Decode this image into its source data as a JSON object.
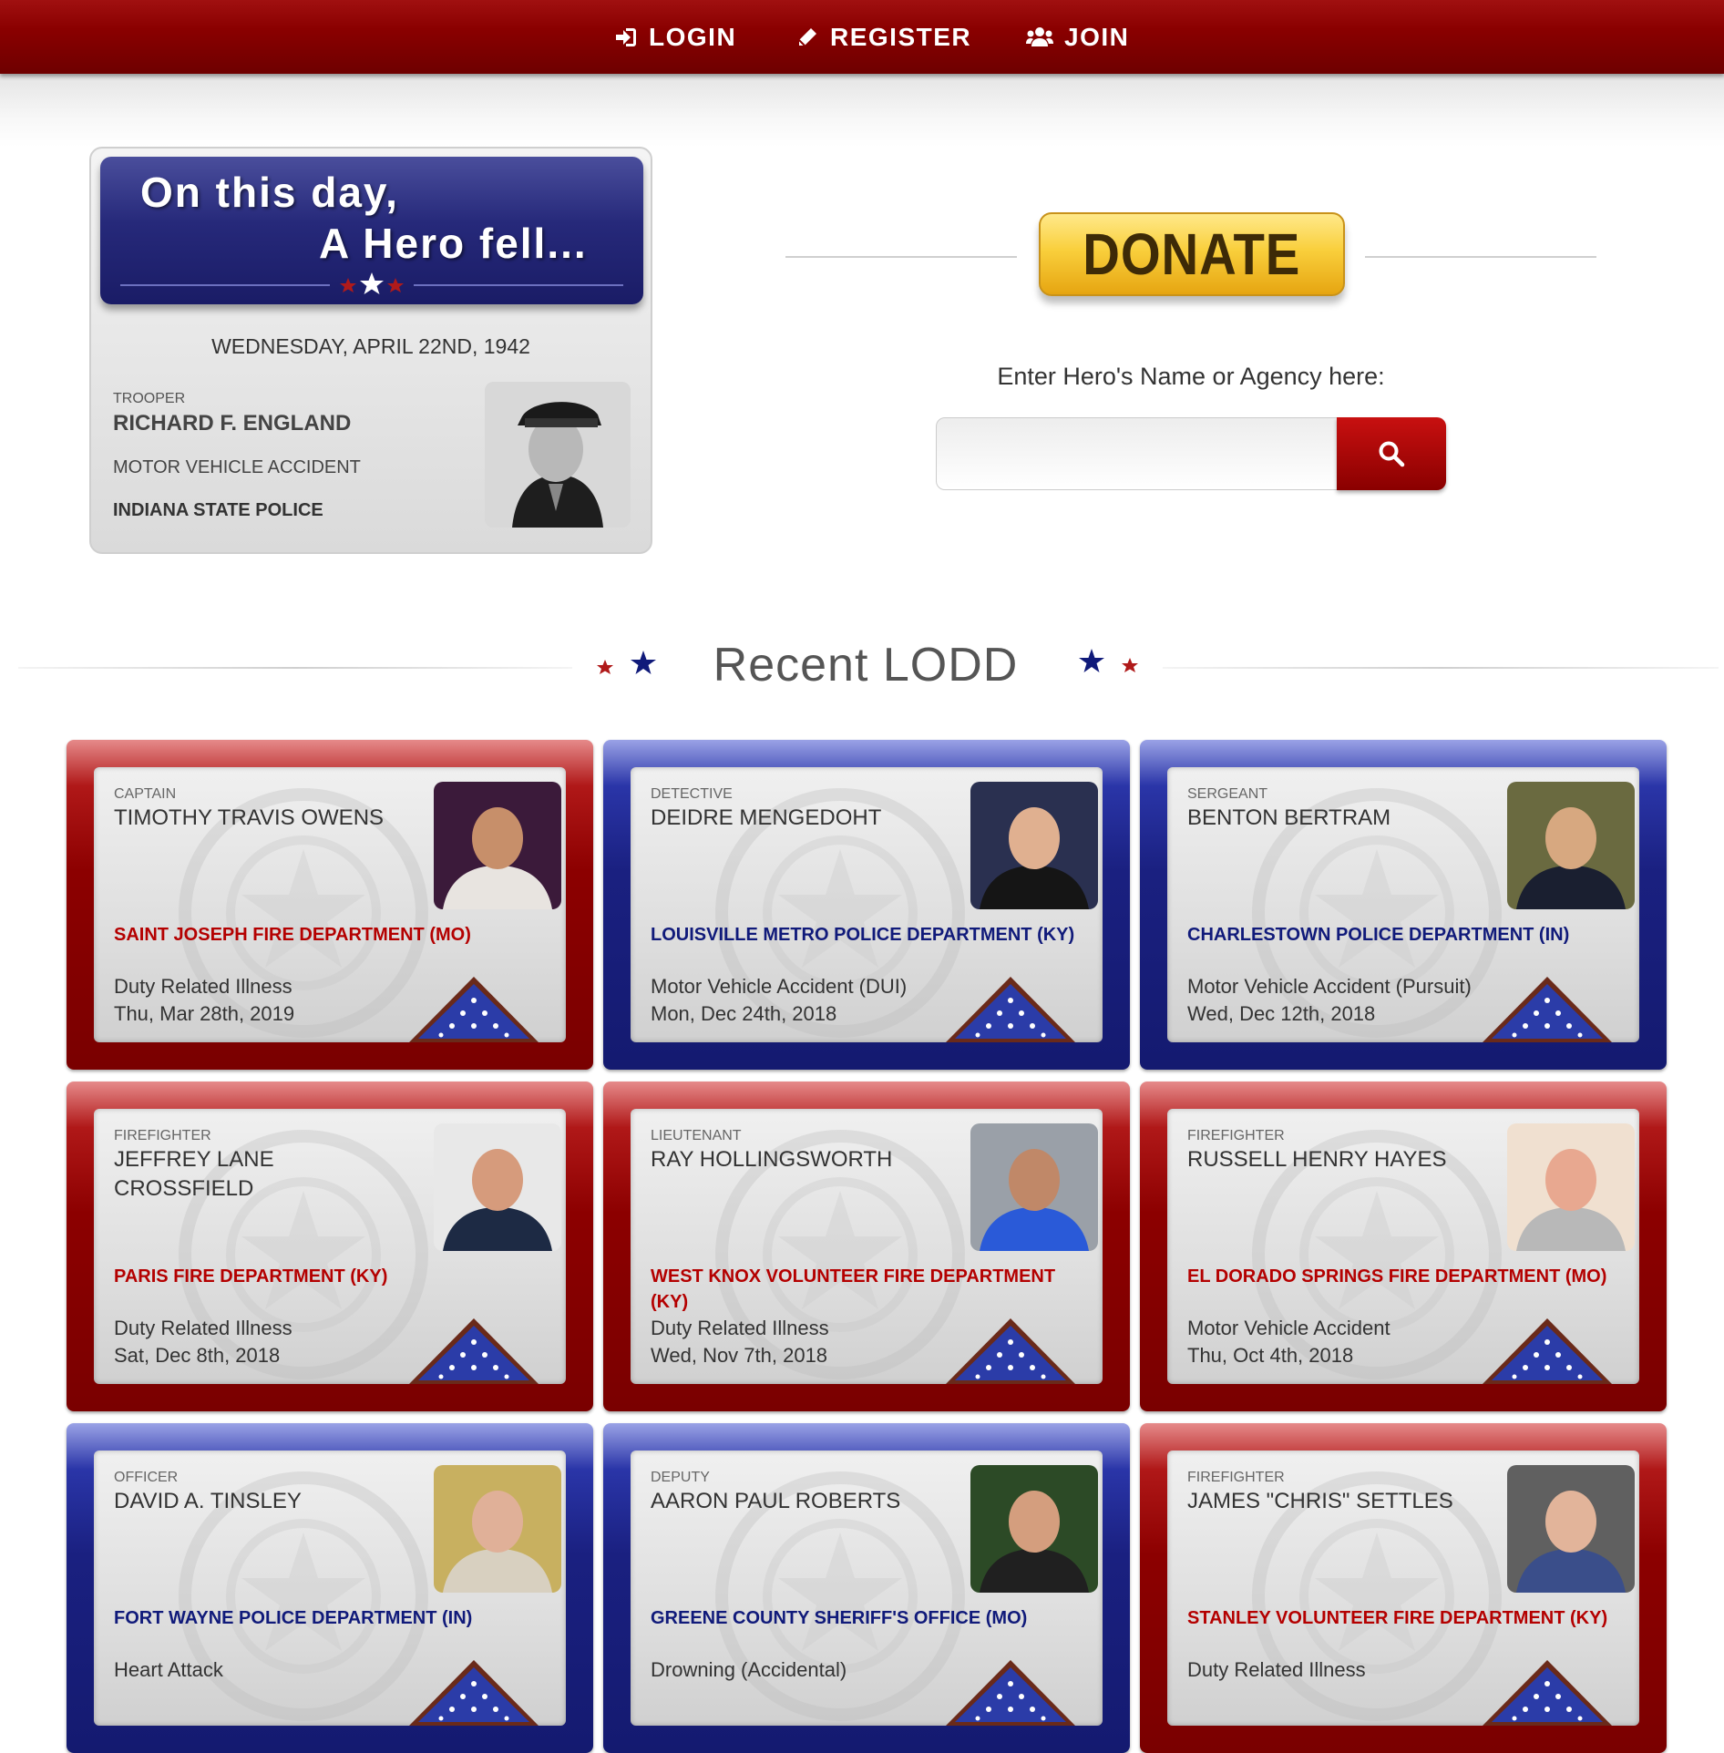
{
  "nav": {
    "login": "LOGIN",
    "register": "REGISTER",
    "join": "JOIN"
  },
  "on_this_day": {
    "line1": "On this day,",
    "line2": "A Hero fell...",
    "date": "WEDNESDAY, APRIL 22ND, 1942",
    "rank": "TROOPER",
    "name": "RICHARD F. ENGLAND",
    "cause": "MOTOR VEHICLE ACCIDENT",
    "agency": "INDIANA STATE POLICE"
  },
  "donate": {
    "label": "DONATE"
  },
  "search": {
    "label": "Enter Hero's Name or Agency here:",
    "value": "",
    "placeholder": ""
  },
  "section": {
    "title": "Recent LODD"
  },
  "cards": [
    {
      "theme": "red",
      "rank": "CAPTAIN",
      "name": "TIMOTHY TRAVIS OWENS",
      "agency": "SAINT JOSEPH FIRE DEPARTMENT (MO)",
      "cause": "Duty Related Illness",
      "date": "Thu, Mar 28th, 2019"
    },
    {
      "theme": "blue",
      "rank": "DETECTIVE",
      "name": "DEIDRE MENGEDOHT",
      "agency": "LOUISVILLE METRO POLICE DEPARTMENT (KY)",
      "cause": "Motor Vehicle Accident (DUI)",
      "date": "Mon, Dec 24th, 2018"
    },
    {
      "theme": "blue",
      "rank": "SERGEANT",
      "name": "BENTON BERTRAM",
      "agency": "CHARLESTOWN POLICE DEPARTMENT (IN)",
      "cause": "Motor Vehicle Accident (Pursuit)",
      "date": "Wed, Dec 12th, 2018"
    },
    {
      "theme": "red",
      "rank": "FIREFIGHTER",
      "name": "JEFFREY LANE CROSSFIELD",
      "agency": "PARIS FIRE DEPARTMENT (KY)",
      "cause": "Duty Related Illness",
      "date": "Sat, Dec 8th, 2018"
    },
    {
      "theme": "red",
      "rank": "LIEUTENANT",
      "name": "RAY HOLLINGSWORTH",
      "agency": "WEST KNOX VOLUNTEER FIRE DEPARTMENT (KY)",
      "cause": "Duty Related Illness",
      "date": "Wed, Nov 7th, 2018"
    },
    {
      "theme": "red",
      "rank": "FIREFIGHTER",
      "name": "RUSSELL HENRY HAYES",
      "agency": "EL DORADO SPRINGS FIRE DEPARTMENT (MO)",
      "cause": "Motor Vehicle Accident",
      "date": "Thu, Oct 4th, 2018"
    },
    {
      "theme": "blue",
      "rank": "OFFICER",
      "name": "DAVID A. TINSLEY",
      "agency": "FORT WAYNE POLICE DEPARTMENT (IN)",
      "cause": "Heart Attack",
      "date": ""
    },
    {
      "theme": "blue",
      "rank": "DEPUTY",
      "name": "AARON PAUL ROBERTS",
      "agency": "GREENE COUNTY SHERIFF'S OFFICE (MO)",
      "cause": "Drowning (Accidental)",
      "date": ""
    },
    {
      "theme": "red",
      "rank": "FIREFIGHTER",
      "name": "JAMES \"CHRIS\" SETTLES",
      "agency": "STANLEY VOLUNTEER FIRE DEPARTMENT (KY)",
      "cause": "Duty Related Illness",
      "date": ""
    }
  ]
}
